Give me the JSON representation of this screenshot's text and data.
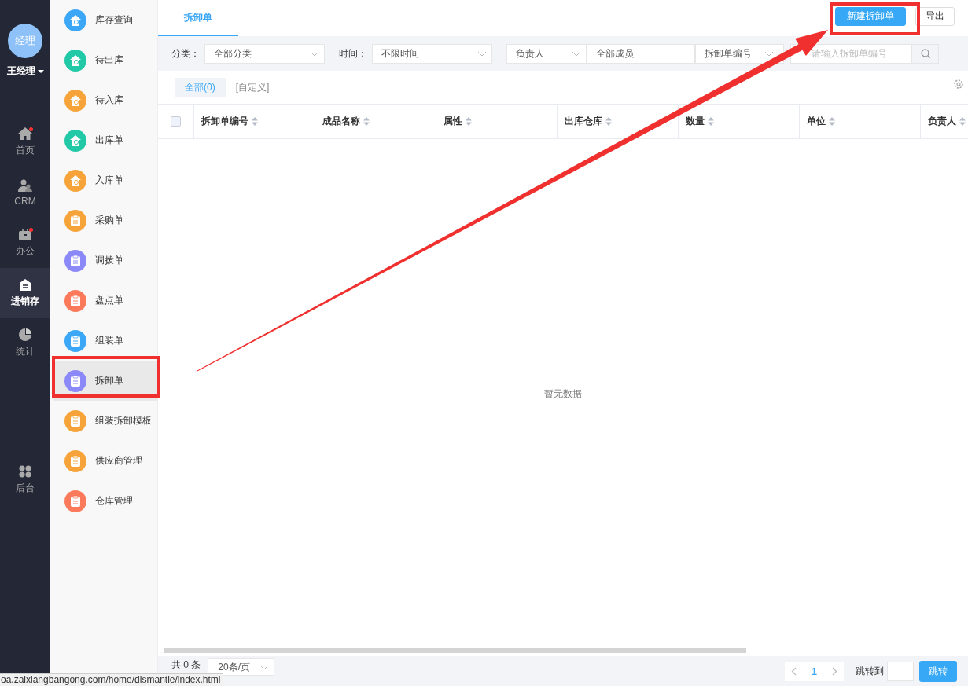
{
  "nav": {
    "avatar": "经理",
    "user": "王经理",
    "items": [
      {
        "label": "首页",
        "badge": true,
        "selected": false
      },
      {
        "label": "CRM",
        "badge": false,
        "selected": false
      },
      {
        "label": "办公",
        "badge": true,
        "selected": false
      },
      {
        "label": "进销存",
        "badge": false,
        "selected": true
      },
      {
        "label": "统计",
        "badge": false,
        "selected": false
      },
      {
        "label": "后台",
        "badge": false,
        "selected": false
      }
    ]
  },
  "submenu": [
    {
      "label": "库存查询",
      "color": "#3ca7f6",
      "selected": false
    },
    {
      "label": "待出库",
      "color": "#22c9a7",
      "selected": false
    },
    {
      "label": "待入库",
      "color": "#f6a43a",
      "selected": false
    },
    {
      "label": "出库单",
      "color": "#22c9a7",
      "selected": false
    },
    {
      "label": "入库单",
      "color": "#f6a43a",
      "selected": false
    },
    {
      "label": "采购单",
      "color": "#f6a43a",
      "selected": false
    },
    {
      "label": "调拨单",
      "color": "#8b88f7",
      "selected": false
    },
    {
      "label": "盘点单",
      "color": "#fb7a5c",
      "selected": false
    },
    {
      "label": "组装单",
      "color": "#3ca7f6",
      "selected": false
    },
    {
      "label": "拆卸单",
      "color": "#8b88f7",
      "selected": true
    },
    {
      "label": "组装拆卸模板",
      "color": "#f6a43a",
      "selected": false
    },
    {
      "label": "供应商管理",
      "color": "#f6a43a",
      "selected": false
    },
    {
      "label": "仓库管理",
      "color": "#fb7a5c",
      "selected": false
    }
  ],
  "tabs": [
    {
      "label": "拆卸单",
      "selected": true
    }
  ],
  "actions": [
    {
      "label": "新建拆卸单",
      "kind": "primary"
    },
    {
      "label": "导出",
      "kind": "default"
    }
  ],
  "filters": {
    "category_label": "分类：",
    "category": "全部分类",
    "time_label": "时间：",
    "time": "不限时间",
    "owner_type": "负责人",
    "owner": "全部成员",
    "search_field": "拆卸单编号",
    "search": {
      "placeholder": "请输入拆卸单编号"
    }
  },
  "views": [
    {
      "label": "全部(0)",
      "selected": true
    },
    {
      "label": "[自定义]",
      "selected": false
    }
  ],
  "table": {
    "select_all": {
      "checked": false
    },
    "columns": [
      "拆卸单编号",
      "成品名称",
      "属性",
      "出库仓库",
      "数量",
      "单位",
      "负责人"
    ],
    "empty": "暂无数据"
  },
  "footer": {
    "total": "共 0 条",
    "page_size": "20条/页",
    "page": "1",
    "jump_label": "跳转到",
    "jump_button": "跳转"
  },
  "status_url": "oa.zaixiangbangong.com/home/dismantle/index.html"
}
